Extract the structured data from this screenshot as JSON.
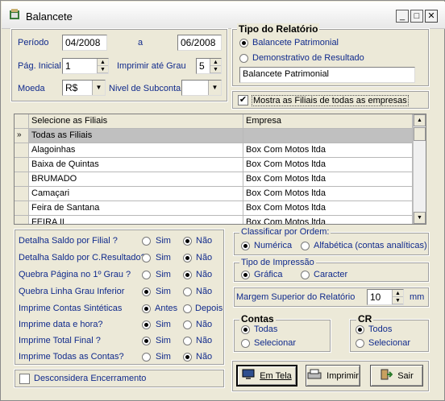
{
  "window": {
    "title": "Balancete"
  },
  "periodo": {
    "label": "Período",
    "start": "04/2008",
    "sep": "a",
    "end": "06/2008"
  },
  "pag": {
    "label": "Pág. Inicial",
    "value": "1",
    "grau_label": "Imprimir até Grau",
    "grau_value": "5"
  },
  "moeda": {
    "label": "Moeda",
    "value": "R$",
    "nivel_label": "Nivel de Subconta",
    "nivel_value": ""
  },
  "tipo_relatorio": {
    "title": "Tipo do Relatório",
    "opt1": "Balancete Patrimonial",
    "opt2": "Demonstrativo de Resultado",
    "field": "Balancete Patrimonial"
  },
  "mostrar_filiais": {
    "label": "Mostra as Filiais de todas as empresas",
    "checked": true
  },
  "grid": {
    "col1": "Selecione as Filiais",
    "col2": "Empresa",
    "rows": [
      {
        "filial": "Todas as Filiais",
        "empresa": ""
      },
      {
        "filial": "Alagoinhas",
        "empresa": "Box Com Motos ltda"
      },
      {
        "filial": "Baixa de Quintas",
        "empresa": "Box Com Motos ltda"
      },
      {
        "filial": "BRUMADO",
        "empresa": "Box Com Motos ltda"
      },
      {
        "filial": "Camaçari",
        "empresa": "Box Com Motos ltda"
      },
      {
        "filial": "Feira de Santana",
        "empresa": "Box Com Motos ltda"
      },
      {
        "filial": "FEIRA II",
        "empresa": "Box Com Motos ltda"
      }
    ]
  },
  "options": {
    "sim": "Sim",
    "nao": "Não",
    "antes": "Antes",
    "depois": "Depois",
    "items": [
      {
        "label": "Detalha Saldo por Filial ?",
        "selected": "nao"
      },
      {
        "label": "Detalha Saldo por C.Resultado?",
        "selected": "nao"
      },
      {
        "label": "Quebra Página no 1º Grau ?",
        "selected": "nao"
      },
      {
        "label": "Quebra Linha Grau Inferior",
        "selected": "sim"
      },
      {
        "label": "Imprime Contas Sintéticas",
        "selected": "antes"
      },
      {
        "label": "Imprime data e hora?",
        "selected": "sim"
      },
      {
        "label": "Imprime Total Final ?",
        "selected": "sim"
      },
      {
        "label": "Imprime Todas as Contas?",
        "selected": "nao"
      }
    ]
  },
  "desconsidera": {
    "label": "Desconsidera Encerramento",
    "checked": false
  },
  "ordem": {
    "title": "Classificar por Ordem:",
    "opt1": "Numérica",
    "opt2": "Alfabética (contas analíticas)"
  },
  "impressao": {
    "title": "Tipo de Impressão",
    "opt1": "Gráfica",
    "opt2": "Caracter"
  },
  "margem": {
    "label": "Margem Superior do Relatório",
    "value": "10",
    "unit": "mm"
  },
  "contas": {
    "title": "Contas",
    "opt1": "Todas",
    "opt2": "Selecionar"
  },
  "cr": {
    "title": "CR",
    "opt1": "Todos",
    "opt2": "Selecionar"
  },
  "buttons": {
    "tela": "Em Tela",
    "imprimir": "Imprimir",
    "sair": "Sair"
  }
}
